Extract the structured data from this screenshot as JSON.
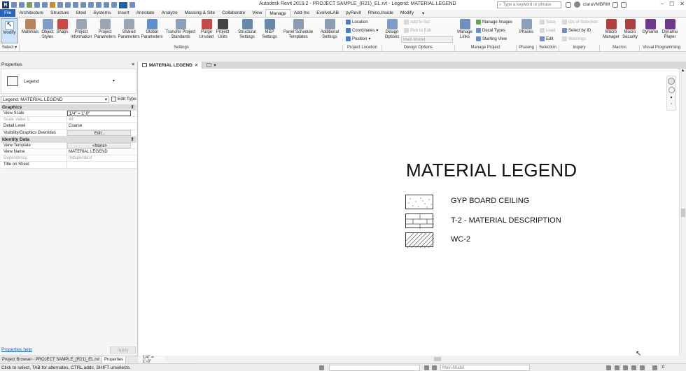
{
  "window": {
    "title": "Autodesk Revit 2019.2 - PROJECT SAMPLE_(R21)_EL.rvt - Legend: MATERIAL LEGEND",
    "search_placeholder": "Type a keyword or phrase",
    "username": "claraVMBRM"
  },
  "tabs": [
    "File",
    "Architecture",
    "Structure",
    "Steel",
    "Systems",
    "Insert",
    "Annotate",
    "Analyze",
    "Massing & Site",
    "Collaborate",
    "View",
    "Manage",
    "Add-Ins",
    "EvolveLAB",
    "pyRevit",
    "Rhino.Inside",
    "Modify"
  ],
  "active_tab": "Manage",
  "ribbon": {
    "modify": "Modify",
    "select_label": "Select ▾",
    "settings_buttons": [
      "Materials",
      "Object Styles",
      "Snaps",
      "Project Information",
      "Project Parameters",
      "Shared Parameters",
      "Global Parameters",
      "Transfer Project Standards",
      "Purge Unused",
      "Project Units",
      "Structural Settings",
      "MEP Settings",
      "Panel Schedule Templates",
      "Additional Settings"
    ],
    "settings_label": "Settings",
    "project_location": [
      "Location",
      "Coordinates",
      "Position"
    ],
    "project_location_label": "Project Location",
    "design_options_btn": "Design Options",
    "design_small": [
      "Add to Set",
      "Pick to Edit"
    ],
    "design_dropdown": "Main Model",
    "design_options_label": "Design Options",
    "manage_links": "Manage Links",
    "manage_project_small": [
      "Manage Images",
      "Decal Types",
      "Starting View"
    ],
    "manage_project_label": "Manage Project",
    "phases": "Phases",
    "phasing_label": "Phasing",
    "selection_small": [
      "Save",
      "Load",
      "Edit"
    ],
    "selection_label": "Selection",
    "inquiry_small": [
      "IDs of Selection",
      "Select by ID",
      "Warnings"
    ],
    "inquiry_label": "Inquiry",
    "macros": [
      "Macro Manager",
      "Macro Security"
    ],
    "macros_label": "Macros",
    "visual_programming": [
      "Dynamo",
      "Dynamo Player"
    ],
    "visual_programming_label": "Visual Programming"
  },
  "properties": {
    "title": "Properties",
    "type_name": "Legend",
    "instance": "Legend: MATERIAL LEGEND",
    "edit_type": "Edit Type",
    "groups": [
      {
        "name": "Graphics",
        "rows": [
          {
            "key": "View Scale",
            "value": "1/4\" = 1'-0\""
          },
          {
            "key": "Scale Value    1:",
            "value": "48"
          },
          {
            "key": "Detail Level",
            "value": "Coarse"
          },
          {
            "key": "Visibility/Graphics Overrides",
            "value": "Edit..."
          }
        ]
      },
      {
        "name": "Identity Data",
        "rows": [
          {
            "key": "View Template",
            "value": "<None>"
          },
          {
            "key": "View Name",
            "value": "MATERIAL LEGEND"
          },
          {
            "key": "Dependency",
            "value": "Independent"
          },
          {
            "key": "Title on Sheet",
            "value": ""
          }
        ]
      }
    ],
    "help": "Properties help",
    "apply": "Apply"
  },
  "browser_tabs": [
    "Project Browser - PROJECT SAMPLE_(R21)_EL.rvt",
    "Properties"
  ],
  "view": {
    "tab_label": "MATERIAL LEGEND",
    "legend_title": "MATERIAL LEGEND",
    "items": [
      "GYP BOARD CEILING",
      "T-2 -  MATERIAL DESCRIPTION",
      "WC-2"
    ],
    "scale_label": "1/4\" = 1'-0\""
  },
  "status": {
    "text": "Click to select, TAB for alternates, CTRL adds, SHIFT unselects.",
    "model": "Main Model"
  },
  "colors": {
    "file_tab": "#2a64c3",
    "modify_active": "#cfe3f7"
  }
}
